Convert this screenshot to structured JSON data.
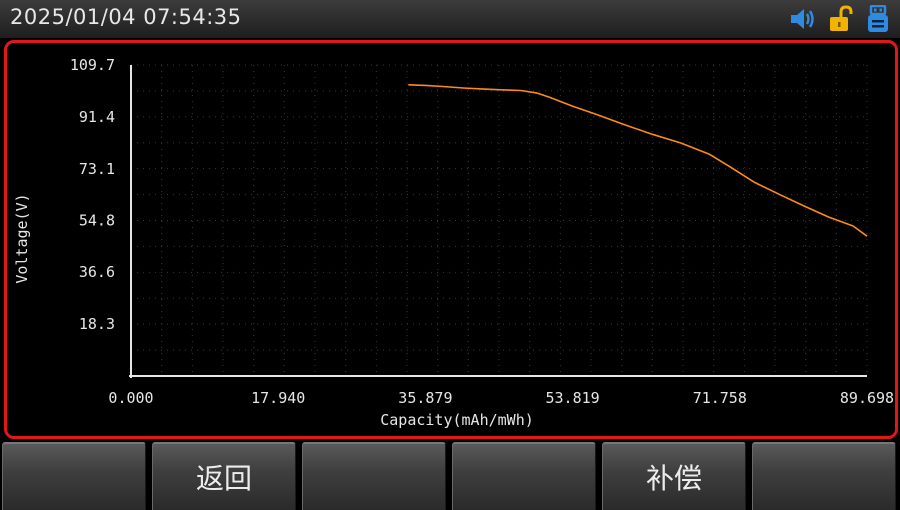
{
  "status_bar": {
    "datetime": "2025/01/04   07:54:35",
    "icons": [
      "speaker-icon",
      "unlock-icon",
      "usb-drive-icon"
    ],
    "icon_colors": {
      "speaker": "#2f8be0",
      "unlock": "#f2b300",
      "usb": "#2f8be0"
    }
  },
  "panel": {
    "border_color": "#e01818"
  },
  "chart_data": {
    "type": "line",
    "xlabel": "Capacity(mAh/mWh)",
    "ylabel": "Voltage(V)",
    "x_ticks": [
      "0.000",
      "17.940",
      "35.879",
      "53.819",
      "71.758",
      "89.698"
    ],
    "y_ticks": [
      "109.7",
      "91.4",
      "73.1",
      "54.8",
      "36.6",
      "18.3"
    ],
    "xlim": [
      0,
      89.698
    ],
    "ylim": [
      0,
      109.7
    ],
    "grid": true,
    "line_color": "#ff8a1a",
    "series": [
      {
        "x": [
          33.8,
          35.9,
          38.0,
          40.5,
          43.0,
          45.5,
          47.5,
          49.5,
          51.0,
          53.8,
          56.5,
          60.0,
          63.5,
          67.0,
          70.5,
          73.0,
          76.0,
          79.0,
          82.0,
          85.0,
          88.0,
          89.7
        ],
        "y": [
          102.7,
          102.5,
          102.1,
          101.6,
          101.2,
          100.9,
          100.7,
          99.8,
          98.3,
          95.2,
          92.5,
          88.8,
          85.3,
          82.2,
          78.2,
          73.8,
          68.3,
          64.1,
          60.0,
          56.1,
          52.9,
          49.3
        ]
      }
    ]
  },
  "buttons": [
    {
      "label": ""
    },
    {
      "label": "返回"
    },
    {
      "label": ""
    },
    {
      "label": ""
    },
    {
      "label": "补偿"
    },
    {
      "label": ""
    }
  ]
}
